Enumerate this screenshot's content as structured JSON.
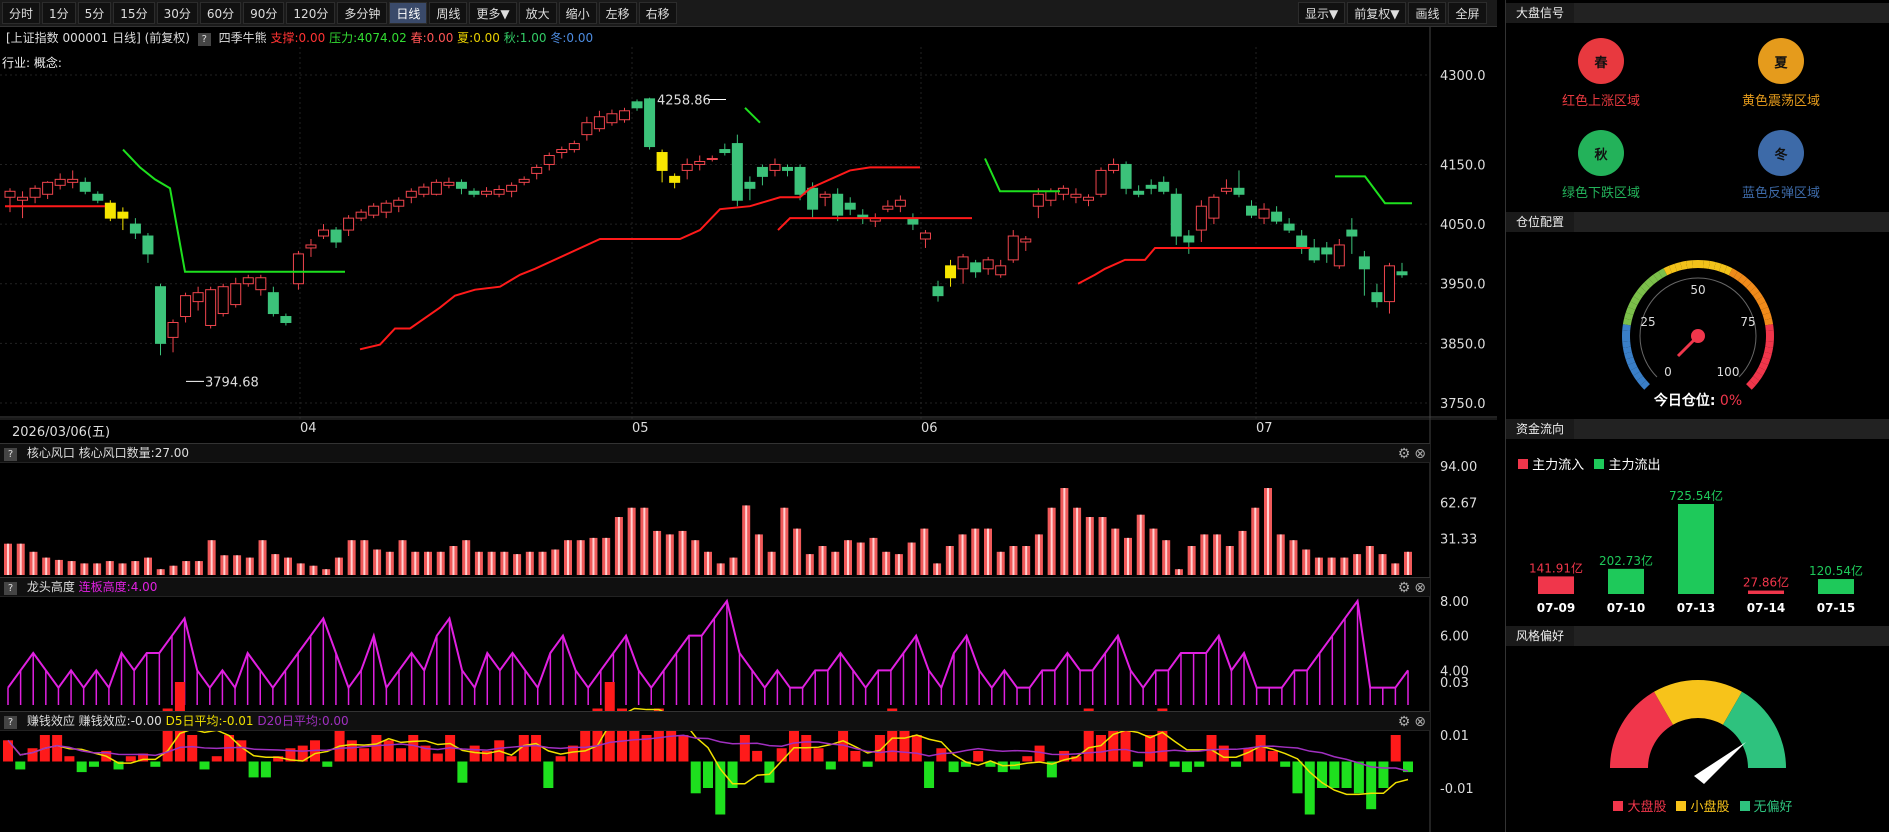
{
  "toolbar": {
    "periods": [
      "分时",
      "1分",
      "5分",
      "15分",
      "30分",
      "60分",
      "90分",
      "120分",
      "多分钟",
      "日线",
      "周线",
      "更多▼",
      "放大",
      "缩小",
      "左移",
      "右移"
    ],
    "active_period": "日线",
    "right_buttons": [
      "显示▼",
      "前复权▼",
      "画线",
      "全屏"
    ]
  },
  "info": {
    "title": "[上证指数 000001 日线] (前复权)",
    "help": "?",
    "indicator": "四季牛熊",
    "support": "支撑:0.00",
    "pressure": "压力:4074.02",
    "spring": "春:0.00",
    "summer": "夏:0.00",
    "autumn": "秋:1.00",
    "winter": "冬:0.00",
    "industry_label": "行业:",
    "concept_label": "概念:"
  },
  "price_axis": [
    "4300.0",
    "4150.0",
    "4050.0",
    "3950.0",
    "3850.0",
    "3750.0"
  ],
  "high_label": "4258.86",
  "low_label": "3794.68",
  "date_axis": {
    "first": "2026/03/06(五)",
    "months": [
      "04",
      "05",
      "06",
      "07"
    ]
  },
  "panel1": {
    "name": "核心风口",
    "value": "核心风口数量:27.00",
    "ticks": [
      "94.00",
      "62.67",
      "31.33"
    ]
  },
  "panel2": {
    "name": "龙头高度",
    "value": "连板高度:4.00",
    "ticks": [
      "8.00",
      "6.00",
      "4.00"
    ]
  },
  "panel3": {
    "name": "赚钱效应",
    "value": "赚钱效应:-0.00",
    "d5": "D5日平均:-0.01",
    "d20": "D20日平均:0.00",
    "ticks": [
      "0.03",
      "0.01",
      "-0.01"
    ]
  },
  "side": {
    "signal_title": "大盘信号",
    "signals": [
      {
        "glyph": "春",
        "label": "红色上涨区域",
        "color": "#e8393f"
      },
      {
        "glyph": "夏",
        "label": "黄色震荡区域",
        "color": "#e59b1c"
      },
      {
        "glyph": "秋",
        "label": "绿色下跌区域",
        "color": "#23b25a"
      },
      {
        "glyph": "冬",
        "label": "蓝色反弹区域",
        "color": "#3d6aa8"
      }
    ],
    "position_title": "仓位配置",
    "gauge_ticks": [
      "0",
      "25",
      "50",
      "75",
      "100"
    ],
    "today_label": "今日仓位:",
    "today_value": "0%",
    "flow_title": "资金流向",
    "flow_in": "主力流入",
    "flow_out": "主力流出",
    "flow": [
      {
        "date": "07-09",
        "value": "141.91亿",
        "amount": 141.91,
        "dir": "in"
      },
      {
        "date": "07-10",
        "value": "202.73亿",
        "amount": 202.73,
        "dir": "out"
      },
      {
        "date": "07-13",
        "value": "725.54亿",
        "amount": 725.54,
        "dir": "out"
      },
      {
        "date": "07-14",
        "value": "27.86亿",
        "amount": 27.86,
        "dir": "in"
      },
      {
        "date": "07-15",
        "value": "120.54亿",
        "amount": 120.54,
        "dir": "out"
      }
    ],
    "style_title": "风格偏好",
    "style_legend": [
      "大盘股",
      "小盘股",
      "无偏好"
    ],
    "style_colors": [
      "#f0364b",
      "#f7c31a",
      "#2ec27e"
    ]
  },
  "colors": {
    "up": "#f0454d",
    "down": "#3cc27a",
    "support": "#ff1a1a",
    "pressure": "#1ee01e",
    "accent": "#3a4a6a"
  }
}
